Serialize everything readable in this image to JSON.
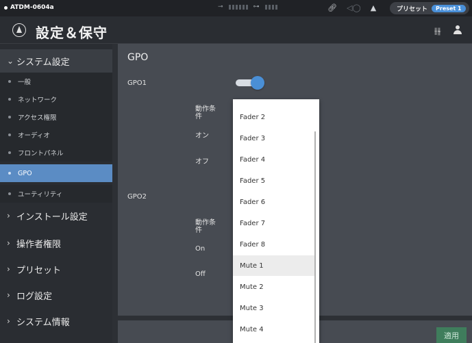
{
  "topbar": {
    "device_name": "ATDM-0604a",
    "preset_label": "プリセット",
    "preset_value": "Preset 1"
  },
  "header": {
    "title": "設定＆保守"
  },
  "sidebar": {
    "system_settings": "システム設定",
    "sub_items": [
      "一般",
      "ネットワーク",
      "アクセス権限",
      "オーディオ",
      "フロントパネル",
      "GPO",
      "ユーティリティ"
    ],
    "active_sub": "GPO",
    "sections": [
      "インストール設定",
      "操作者権限",
      "プリセット",
      "ログ設定",
      "システム情報"
    ]
  },
  "main": {
    "title": "GPO",
    "gpo1": {
      "label": "GPO1",
      "condition_label": "動作条件",
      "on_label": "オン",
      "off_label": "オフ",
      "enabled": true
    },
    "gpo2": {
      "label": "GPO2",
      "condition_label": "動作条件",
      "on_label": "On",
      "off_label": "Off"
    }
  },
  "dropdown": {
    "options": [
      "Fader 2",
      "Fader 3",
      "Fader 4",
      "Fader 5",
      "Fader 6",
      "Fader 7",
      "Fader 8",
      "Mute 1",
      "Mute 2",
      "Mute 3",
      "Mute 4"
    ],
    "highlighted": "Mute 1"
  },
  "footer": {
    "apply_label": "適用"
  },
  "colors": {
    "accent": "#4a8fd6",
    "active_nav": "#5b8cc4",
    "apply": "#3f7d5c"
  }
}
